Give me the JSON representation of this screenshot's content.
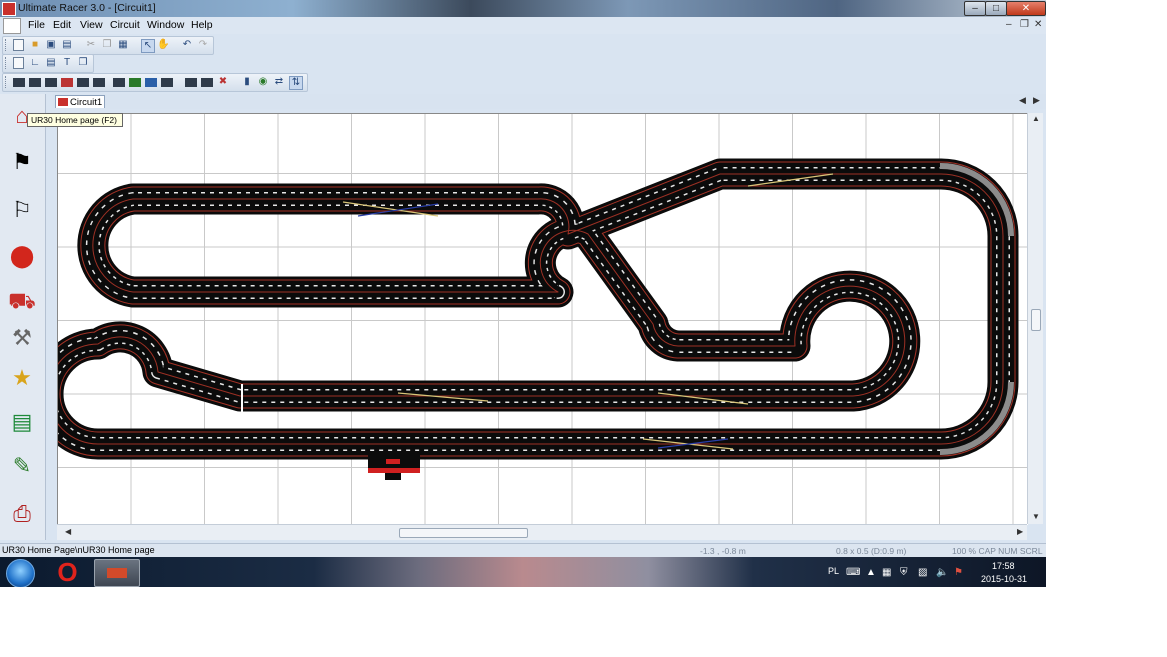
{
  "window": {
    "title": "Ultimate Racer 3.0 - [Circuit1]"
  },
  "menu": {
    "items": [
      "File",
      "Edit",
      "View",
      "Circuit",
      "Window",
      "Help"
    ]
  },
  "sidebar": {
    "tooltip": "UR30 Home page (F2)",
    "icons": [
      "home-garage-icon",
      "checkered-flag-icon",
      "race-flags-icon",
      "helmet-icon",
      "race-car-icon",
      "tools-icon",
      "trophy-icon",
      "chart-icon",
      "pencil-edit-icon",
      "printer-icon"
    ]
  },
  "tabs": {
    "active": "Circuit1"
  },
  "statusbar": {
    "message": "UR30 Home Page\\nUR30 Home page",
    "coords": "-1.3 , -0.8 m",
    "size": "0.8 x 0.5  (D:0.9 m)",
    "zoom_caps": "100 %  CAP  NUM  SCRL"
  },
  "taskbar": {
    "language": "PL",
    "time": "17:58",
    "date": "2015-10-31"
  },
  "colors": {
    "track": "#0b0b0b",
    "rail": "#c0392b",
    "lane_dash": "#e6e6e6",
    "titlebar": "#5a7696"
  }
}
